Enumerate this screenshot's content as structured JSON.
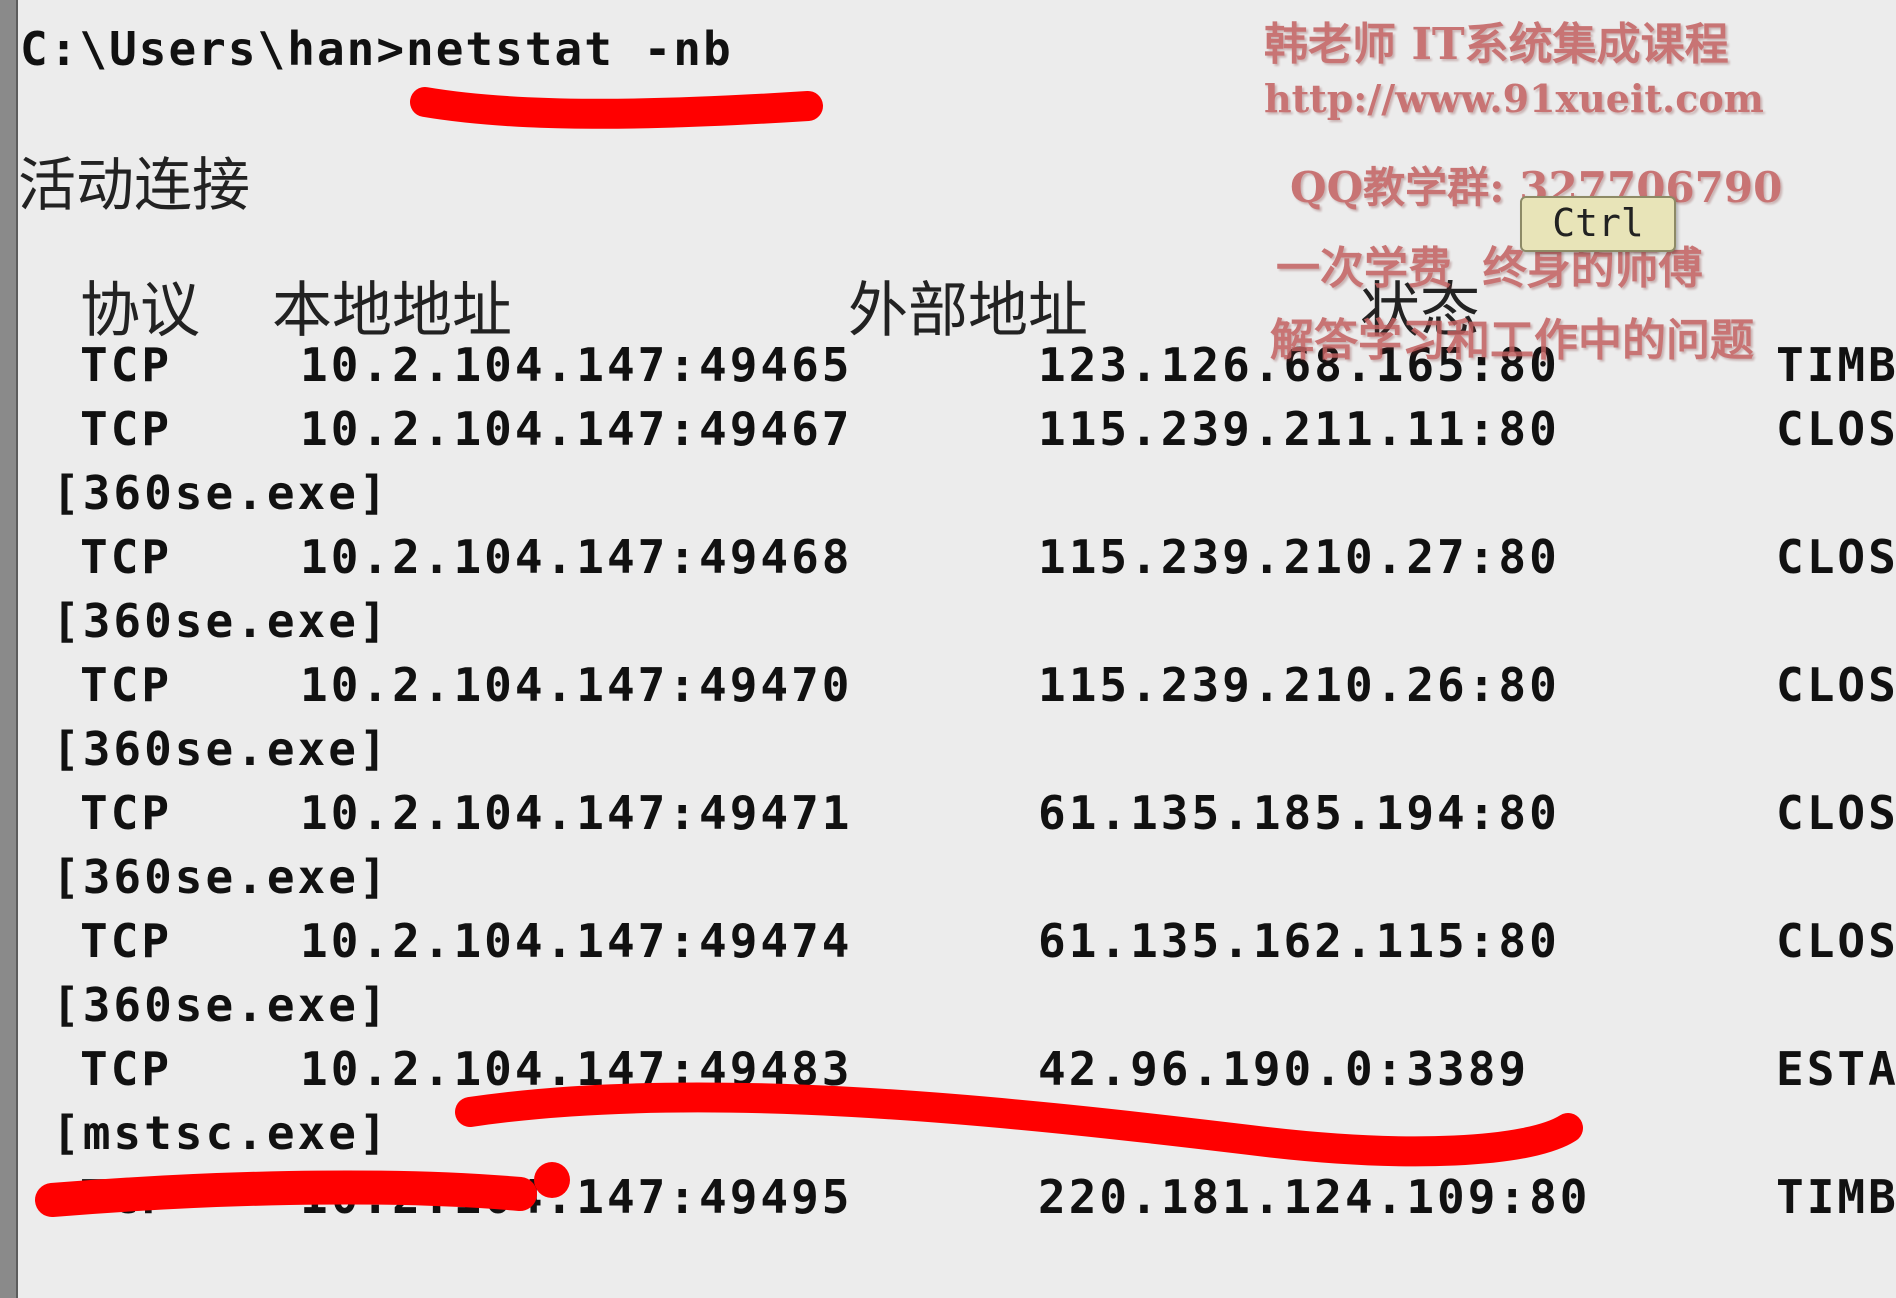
{
  "terminal": {
    "prompt": "C:\\Users\\han>",
    "command": "netstat -nb",
    "section_title": "活动连接",
    "headers": {
      "protocol": "协议",
      "local": "本地地址",
      "foreign": "外部地址",
      "state": "状态"
    },
    "rows": [
      {
        "proto": "TCP",
        "local": "10.2.104.147:49465",
        "foreign": "123.126.68.165:80",
        "state": "TIMB",
        "exe": ""
      },
      {
        "proto": "TCP",
        "local": "10.2.104.147:49467",
        "foreign": "115.239.211.11:80",
        "state": "CLOS",
        "exe": "[360se.exe]"
      },
      {
        "proto": "TCP",
        "local": "10.2.104.147:49468",
        "foreign": "115.239.210.27:80",
        "state": "CLOS",
        "exe": "[360se.exe]"
      },
      {
        "proto": "TCP",
        "local": "10.2.104.147:49470",
        "foreign": "115.239.210.26:80",
        "state": "CLOS",
        "exe": "[360se.exe]"
      },
      {
        "proto": "TCP",
        "local": "10.2.104.147:49471",
        "foreign": "61.135.185.194:80",
        "state": "CLOS",
        "exe": "[360se.exe]"
      },
      {
        "proto": "TCP",
        "local": "10.2.104.147:49474",
        "foreign": "61.135.162.115:80",
        "state": "CLOS",
        "exe": "[360se.exe]"
      },
      {
        "proto": "TCP",
        "local": "10.2.104.147:49483",
        "foreign": "42.96.190.0:3389",
        "state": "ESTA",
        "exe": "[mstsc.exe]"
      },
      {
        "proto": "TCP",
        "local": "10.2.104.147:49495",
        "foreign": "220.181.124.109:80",
        "state": "TIMB",
        "exe": ""
      }
    ]
  },
  "watermark": {
    "line1": "韩老师 IT系统集成课程",
    "line2": "http://www.91xueit.com",
    "line3": "QQ教学群: 327706790",
    "line4": "一次学费  终身的师傅",
    "line5": "解答学习和工作中的问题"
  },
  "tooltip": {
    "text": "Ctrl"
  },
  "colors": {
    "background": "#ececec",
    "text": "#111111",
    "watermark": "#c26060",
    "annotation": "#ff0000",
    "tooltip_bg": "#e8e4b8"
  }
}
